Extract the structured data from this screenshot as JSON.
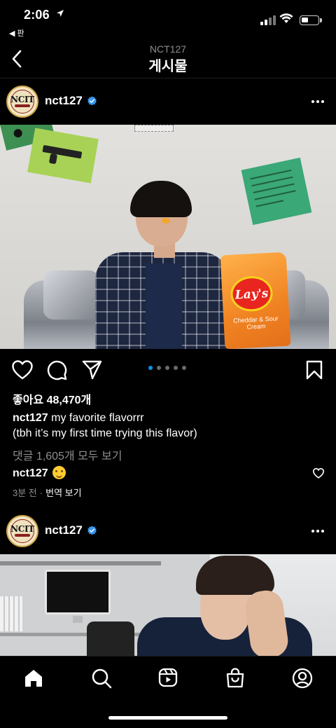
{
  "status_bar": {
    "time": "2:06",
    "back_app": "◀ 판"
  },
  "header": {
    "subtitle": "NCT127",
    "title": "게시물"
  },
  "post1": {
    "username": "nct127",
    "avatar_text": "NCIT",
    "carousel": {
      "count": 5,
      "active_index": 0
    },
    "likes": "좋아요 48,470개",
    "caption_user": "nct127",
    "caption_text": " my favorite flavorrr",
    "caption_line2": "(tbh it’s my first time trying this flavor)",
    "view_comments": "댓글 1,605개 모두 보기",
    "comment_user": "nct127",
    "time_ago": "3분 전",
    "separator": "·",
    "translate": "번역 보기",
    "photo_text": {
      "brand": "Lay's",
      "flavor": "Cheddar & Sour Cream"
    }
  },
  "post2": {
    "username": "nct127",
    "avatar_text": "NCIT"
  },
  "colors": {
    "accent": "#0095f6",
    "background": "#000000",
    "muted": "#8e8e8e"
  },
  "tabs": [
    {
      "name": "home-icon"
    },
    {
      "name": "search-icon"
    },
    {
      "name": "reels-icon"
    },
    {
      "name": "shop-icon"
    },
    {
      "name": "profile-icon"
    }
  ]
}
